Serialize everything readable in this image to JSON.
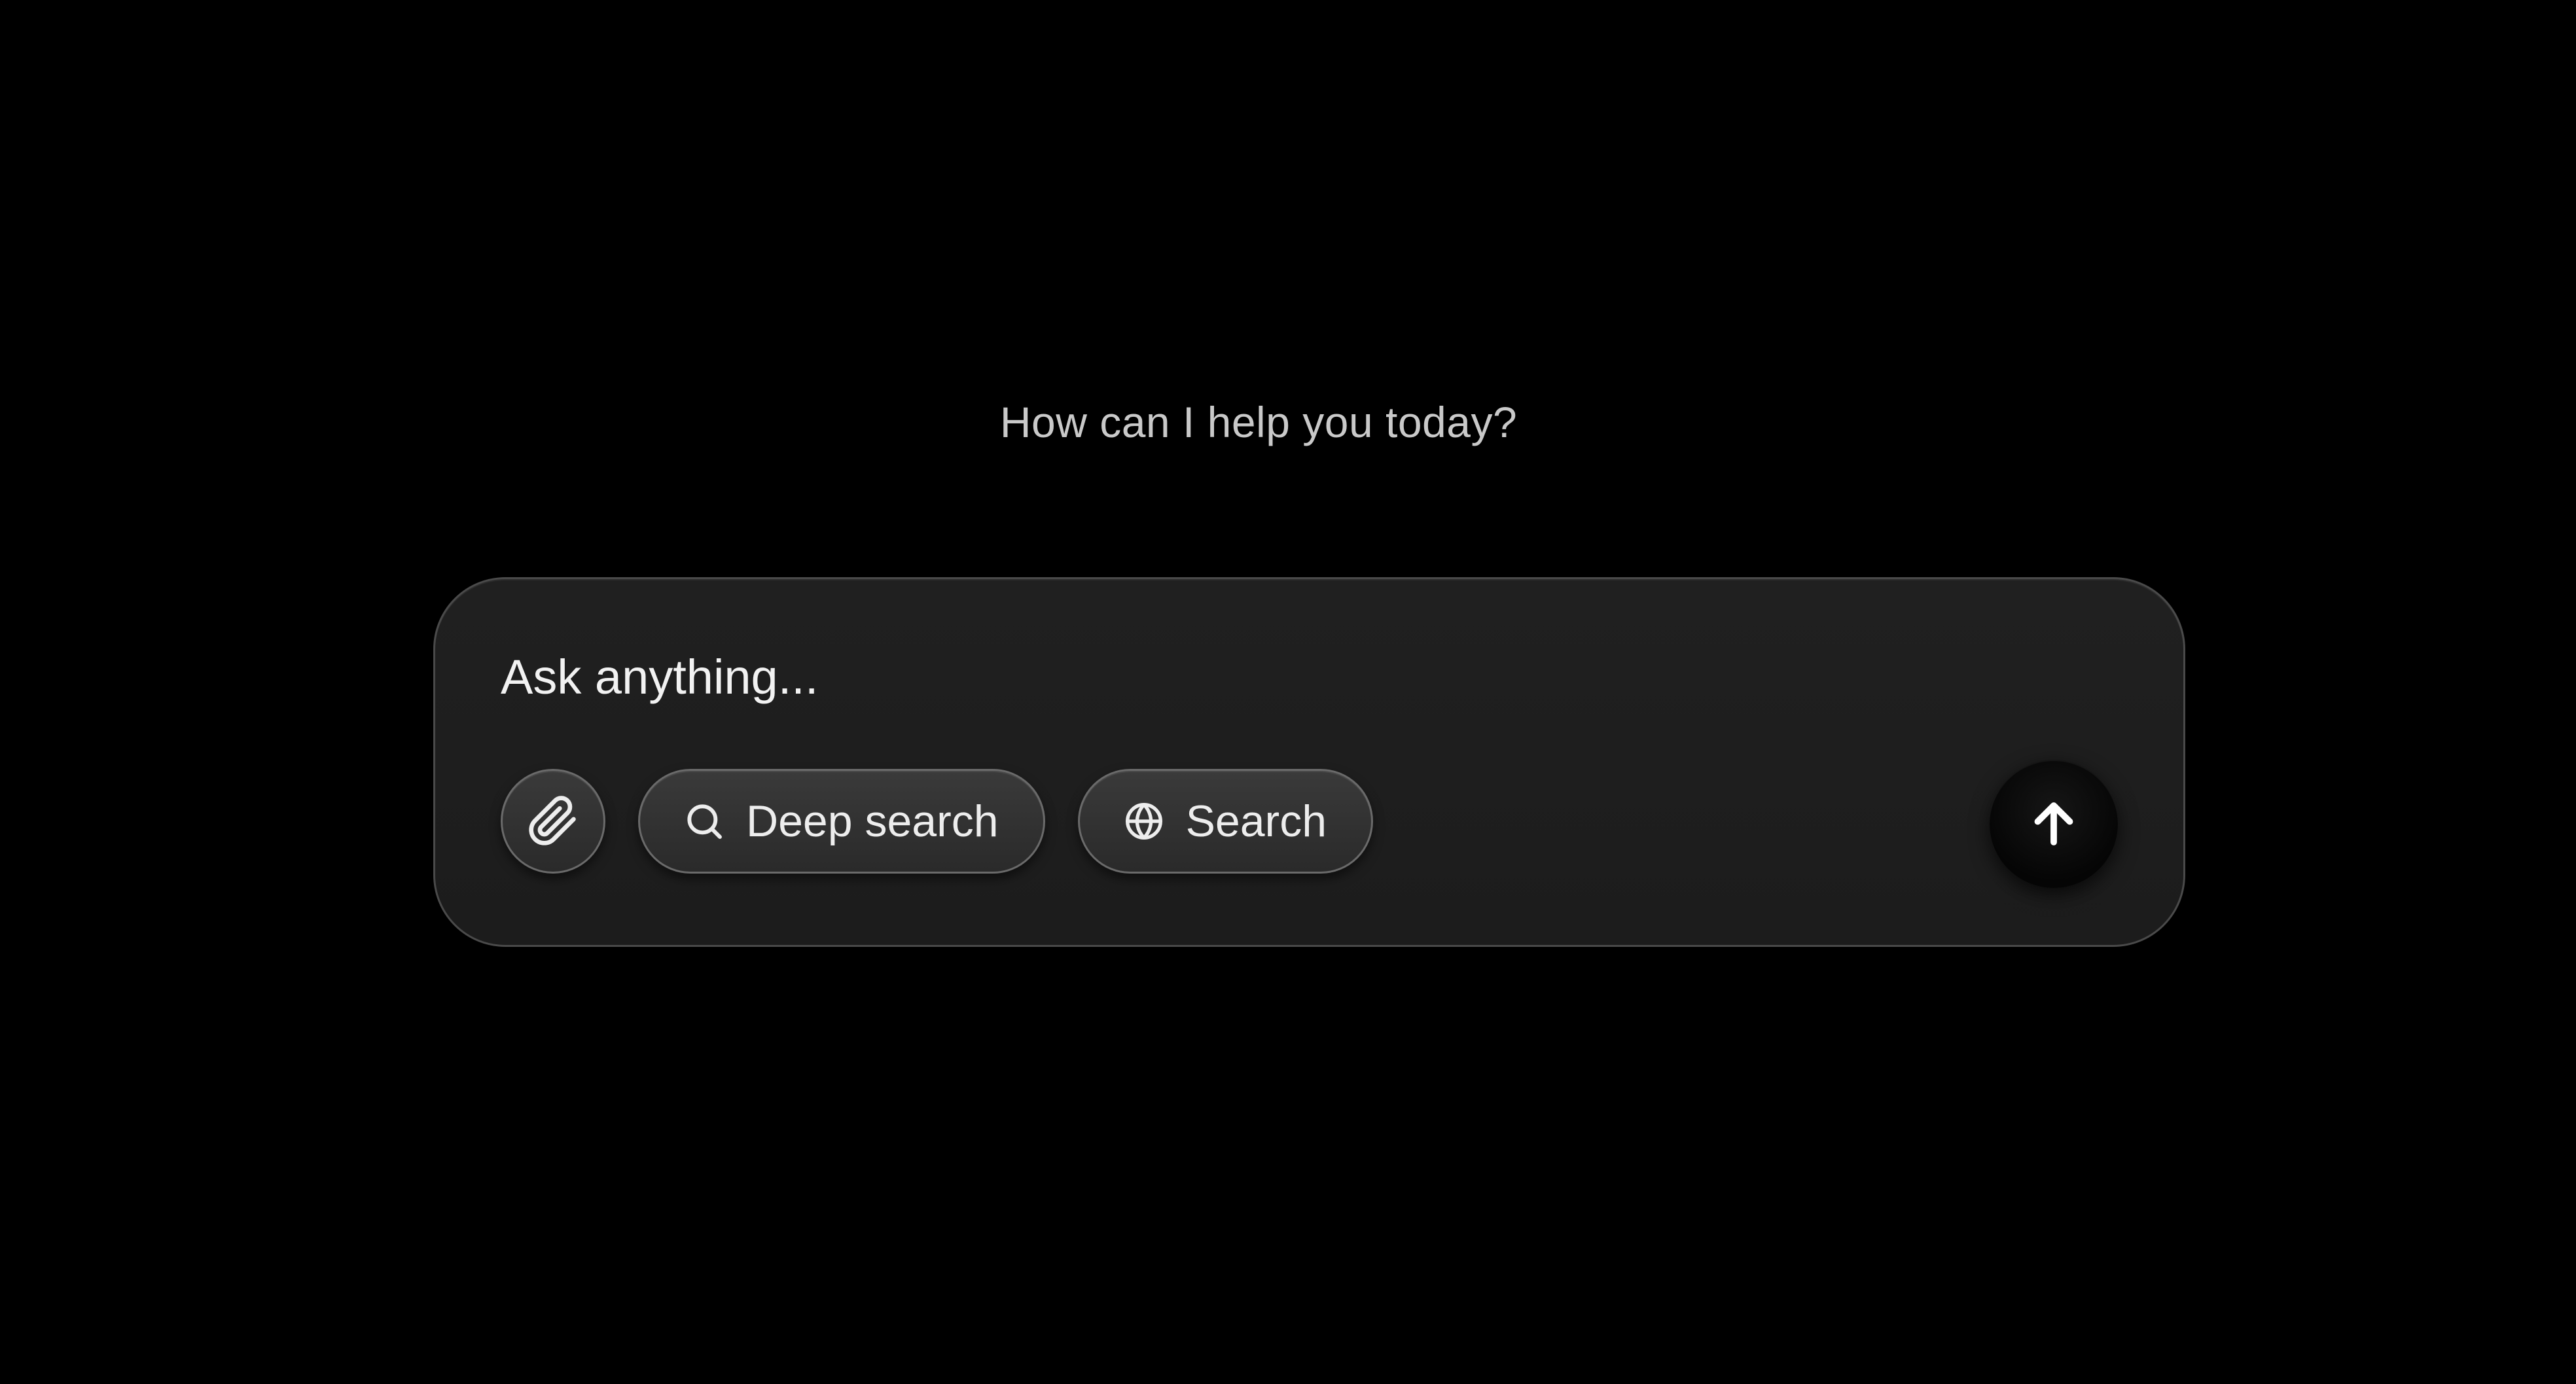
{
  "greeting": "How can I help you today?",
  "composer": {
    "placeholder": "Ask anything...",
    "attach_icon": "paperclip-icon",
    "deep_search": {
      "label": "Deep search",
      "icon": "search-icon"
    },
    "search": {
      "label": "Search",
      "icon": "globe-icon"
    },
    "send_icon": "arrow-up-icon"
  },
  "colors": {
    "background": "#000000",
    "composer_bg": "#1e1e1e",
    "pill_bg": "#333333",
    "text": "#f2f2f2",
    "muted_text": "#c9c9c9"
  }
}
